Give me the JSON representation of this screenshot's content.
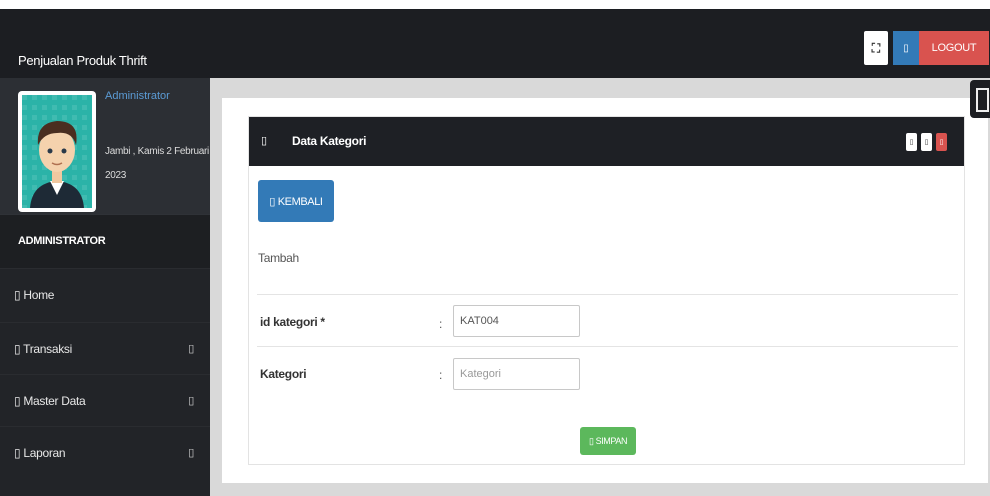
{
  "app": {
    "title": "Penjualan Produk Thrift"
  },
  "topbar": {
    "expand_glyph": "⛶",
    "user_glyph": "▯",
    "logout_label": "LOGOUT"
  },
  "profile": {
    "role_link": "Administrator",
    "date": "Jambi , Kamis 2 Februari 2023"
  },
  "sidebar": {
    "heading": "ADMINISTRATOR",
    "items": [
      {
        "label": "▯ Home",
        "caret": ""
      },
      {
        "label": "▯ Transaksi",
        "caret": "▯"
      },
      {
        "label": "▯ Master Data",
        "caret": "▯"
      },
      {
        "label": "▯ Laporan",
        "caret": "▯"
      }
    ]
  },
  "panel": {
    "icon": "▯",
    "title": "Data Kategori",
    "tools": [
      "▯",
      "▯",
      "▯"
    ],
    "back_label": "▯ KEMBALI",
    "subtitle": "Tambah",
    "fields": [
      {
        "label": "id kategori *",
        "value": "KAT004",
        "placeholder": ""
      },
      {
        "label": "Kategori",
        "value": "",
        "placeholder": "Kategori"
      }
    ],
    "colon": ":",
    "save_label": "▯ SIMPAN"
  },
  "colors": {
    "topbar": "#1c1e22",
    "sidebar": "#222428",
    "primary": "#337ab7",
    "danger": "#d9534f",
    "success": "#5cb85c"
  }
}
